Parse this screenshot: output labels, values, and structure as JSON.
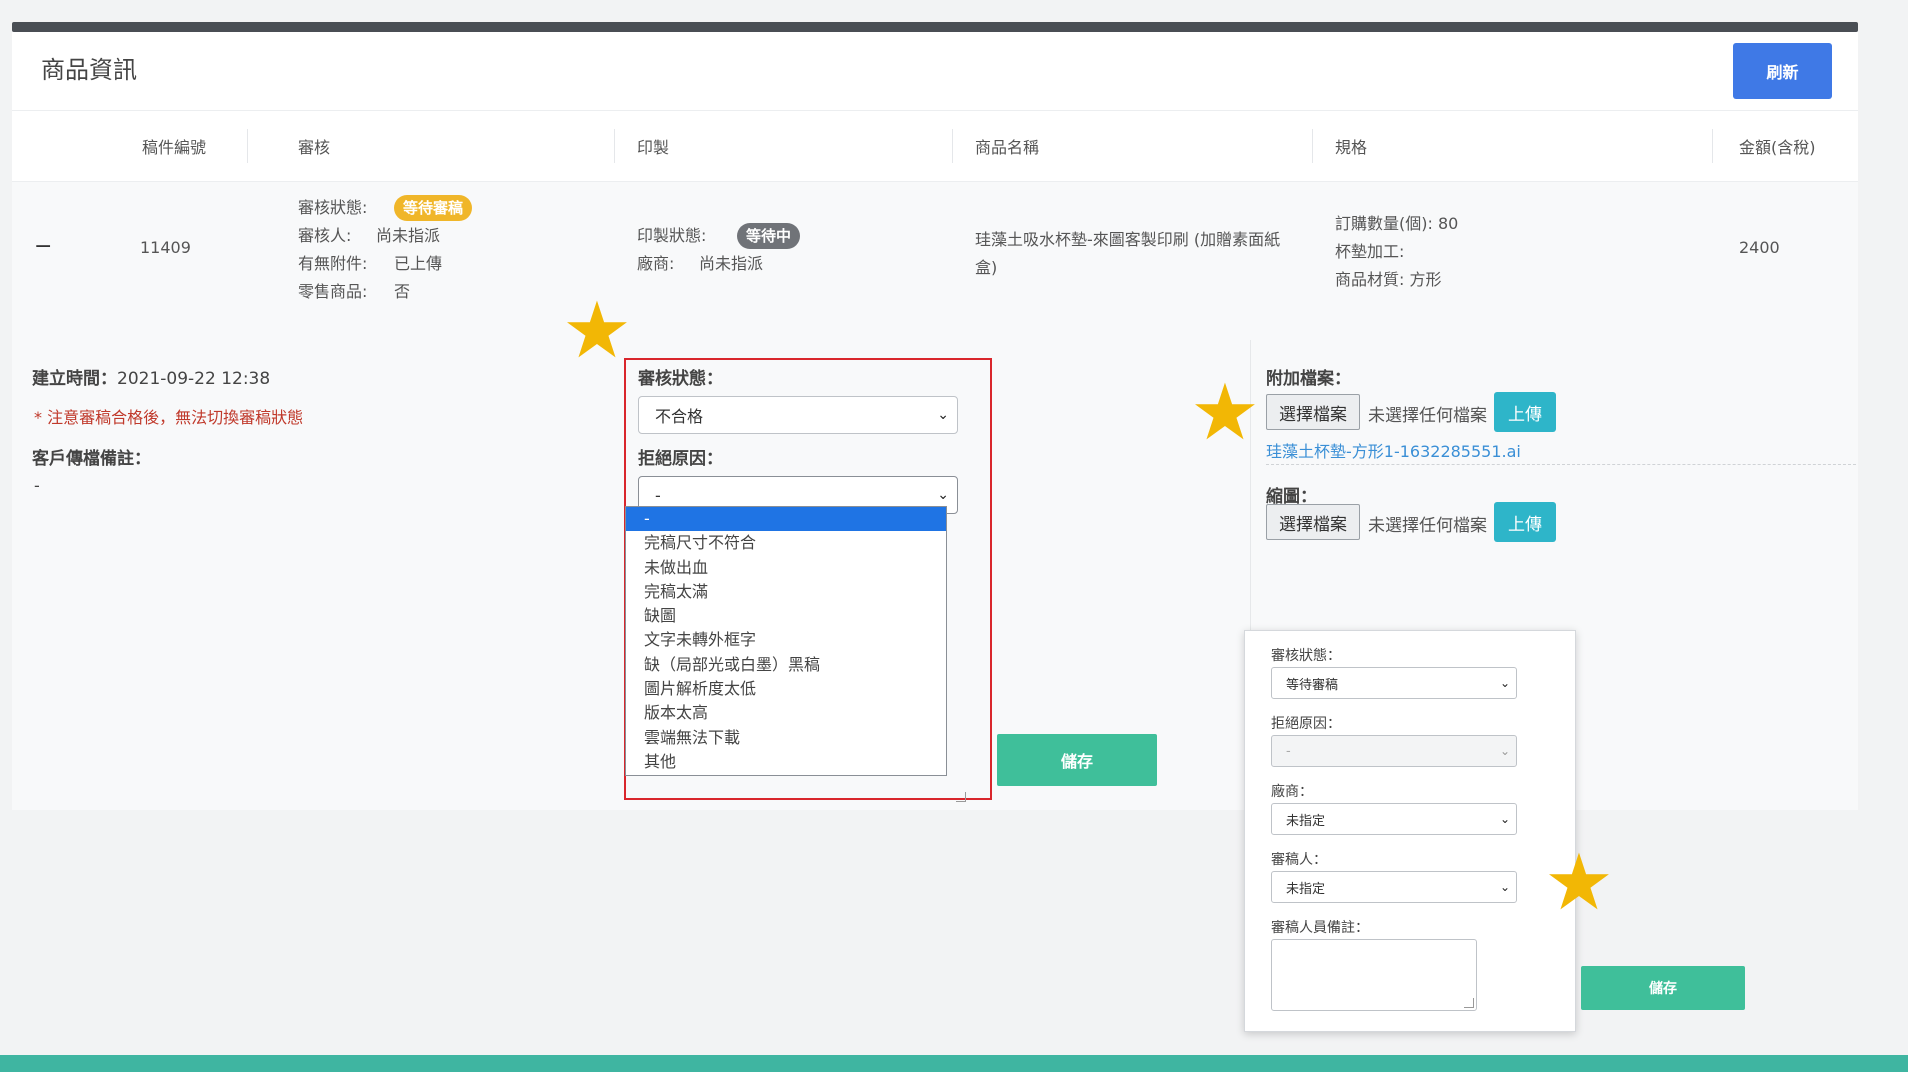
{
  "header": {
    "title": "商品資訊",
    "refresh_label": "刷新"
  },
  "table": {
    "columns": [
      "稿件編號",
      "審核",
      "印製",
      "商品名稱",
      "規格",
      "金額(含稅)"
    ],
    "row": {
      "collapse_symbol": "−",
      "manuscript_id": "11409",
      "review": {
        "status_label": "審核狀態:",
        "status_badge": "等待審稿",
        "reviewer_label": "審核人:",
        "reviewer_value": "尚未指派",
        "attachment_label": "有無附件:",
        "attachment_value": "已上傳",
        "retail_label": "零售商品:",
        "retail_value": "否"
      },
      "print": {
        "status_label": "印製狀態:",
        "status_badge": "等待中",
        "vendor_label": "廠商:",
        "vendor_value": "尚未指派"
      },
      "product_name": "珪藻土吸水杯墊-來圖客製印刷 (加贈素面紙盒)",
      "spec": {
        "quantity": "訂購數量(個): 80",
        "processing": "杯墊加工:",
        "material": "商品材質: 方形"
      },
      "amount": "2400"
    }
  },
  "detail": {
    "created_label": "建立時間：",
    "created_value": "2021-09-22 12:38",
    "warning": "* 注意審稿合格後，無法切換審稿狀態",
    "client_note_label": "客戶傳檔備註：",
    "client_note_value": "-",
    "review_status_label": "審核狀態：",
    "review_status_value": "不合格",
    "reject_reason_label": "拒絕原因：",
    "reject_reason_value": "-",
    "reject_reason_options": [
      "-",
      "完稿尺寸不符合",
      "未做出血",
      "完稿太滿",
      "缺圖",
      "文字未轉外框字",
      "缺（局部光或白墨）黑稿",
      "圖片解析度太低",
      "版本太高",
      "雲端無法下載",
      "其他"
    ],
    "save_label": "儲存",
    "attachment_label": "附加檔案：",
    "choose_file_label": "選擇檔案",
    "no_file_label": "未選擇任何檔案",
    "upload_label": "上傳",
    "attached_file": "珪藻土杯墊-方形1-1632285551.ai",
    "thumbnail_label": "縮圖："
  },
  "popup": {
    "review_status_label": "審核狀態：",
    "review_status_value": "等待審稿",
    "reject_reason_label": "拒絕原因：",
    "reject_reason_value": "-",
    "vendor_label": "廠商：",
    "vendor_value": "未指定",
    "reviewer_label": "審稿人：",
    "reviewer_value": "未指定",
    "reviewer_note_label": "審稿人員備註：",
    "save_label": "儲存"
  },
  "colors": {
    "primary": "#3f79e6",
    "save": "#3fbf9a",
    "upload": "#2eb5c9",
    "badge_waiting_review": "#f0b629",
    "badge_waiting": "#707378",
    "highlight_box": "#d9262c",
    "star": "#f2b705",
    "bottom_bar": "#3fb5a1"
  }
}
